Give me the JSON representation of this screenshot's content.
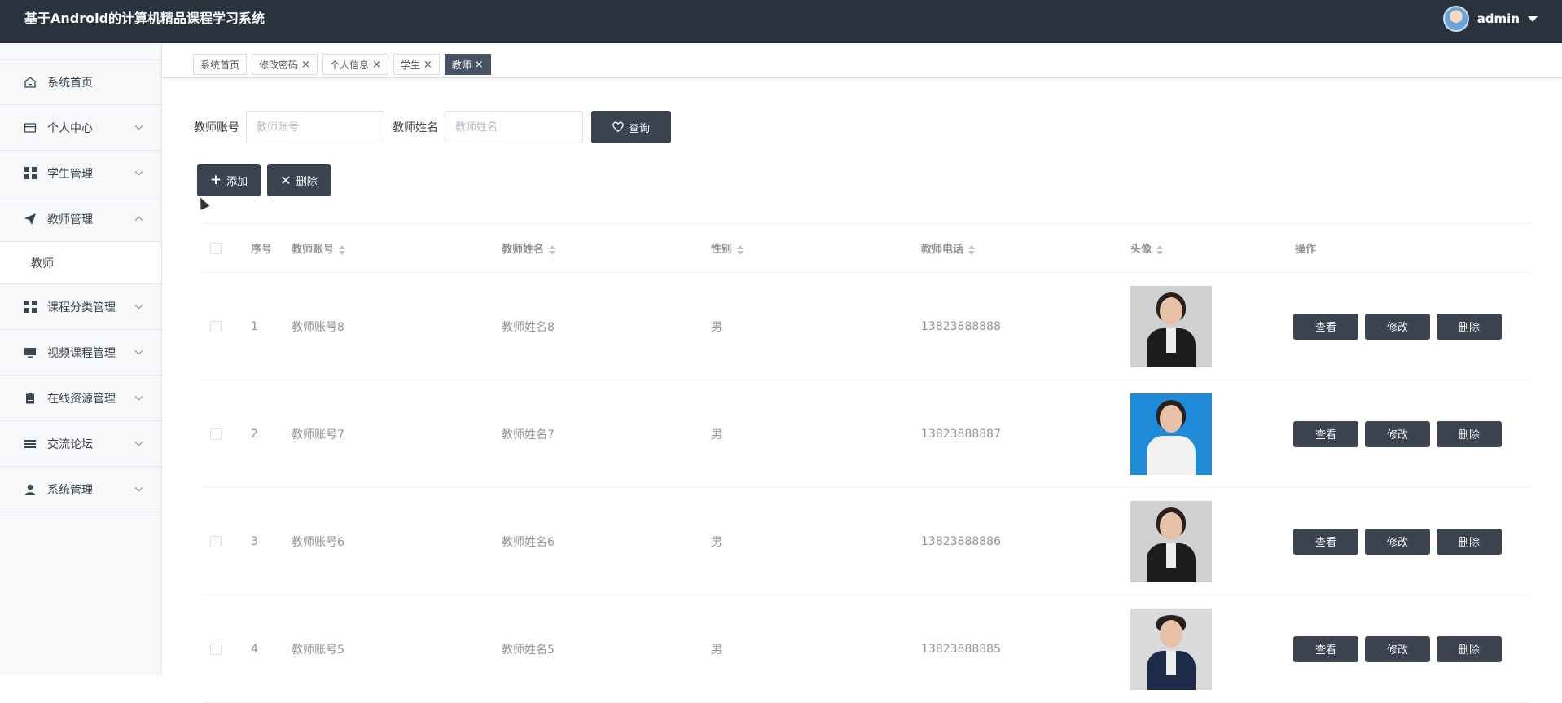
{
  "header": {
    "title": "基于Android的计算机精品课程学习系统",
    "user": "admin"
  },
  "sidebar": {
    "items": [
      {
        "label": "系统首页",
        "icon": "home-icon"
      },
      {
        "label": "个人中心",
        "icon": "card-icon"
      },
      {
        "label": "学生管理",
        "icon": "grid-icon"
      },
      {
        "label": "教师管理",
        "icon": "send-icon",
        "expanded": true
      },
      {
        "label": "课程分类管理",
        "icon": "grid-icon"
      },
      {
        "label": "视频课程管理",
        "icon": "monitor-icon"
      },
      {
        "label": "在线资源管理",
        "icon": "clipboard-icon"
      },
      {
        "label": "交流论坛",
        "icon": "menu-icon"
      },
      {
        "label": "系统管理",
        "icon": "user-icon"
      }
    ],
    "sub_item": "教师"
  },
  "tabs": [
    {
      "label": "系统首页",
      "closable": false
    },
    {
      "label": "修改密码",
      "closable": true
    },
    {
      "label": "个人信息",
      "closable": true
    },
    {
      "label": "学生",
      "closable": true
    },
    {
      "label": "教师",
      "closable": true,
      "active": true
    }
  ],
  "search": {
    "account_label": "教师账号",
    "account_placeholder": "教师账号",
    "name_label": "教师姓名",
    "name_placeholder": "教师姓名",
    "query_label": "查询"
  },
  "actions": {
    "add_label": "添加",
    "delete_label": "删除"
  },
  "table": {
    "headers": {
      "index": "序号",
      "account": "教师账号",
      "name": "教师姓名",
      "gender": "性别",
      "phone": "教师电话",
      "avatar": "头像",
      "ops": "操作"
    },
    "rows": [
      {
        "index": "1",
        "account": "教师账号8",
        "name": "教师姓名8",
        "gender": "男",
        "phone": "13823888888"
      },
      {
        "index": "2",
        "account": "教师账号7",
        "name": "教师姓名7",
        "gender": "男",
        "phone": "13823888887"
      },
      {
        "index": "3",
        "account": "教师账号6",
        "name": "教师姓名6",
        "gender": "男",
        "phone": "13823888886"
      },
      {
        "index": "4",
        "account": "教师账号5",
        "name": "教师姓名5",
        "gender": "男",
        "phone": "13823888885"
      }
    ],
    "op_labels": {
      "view": "查看",
      "edit": "修改",
      "delete": "删除"
    }
  }
}
